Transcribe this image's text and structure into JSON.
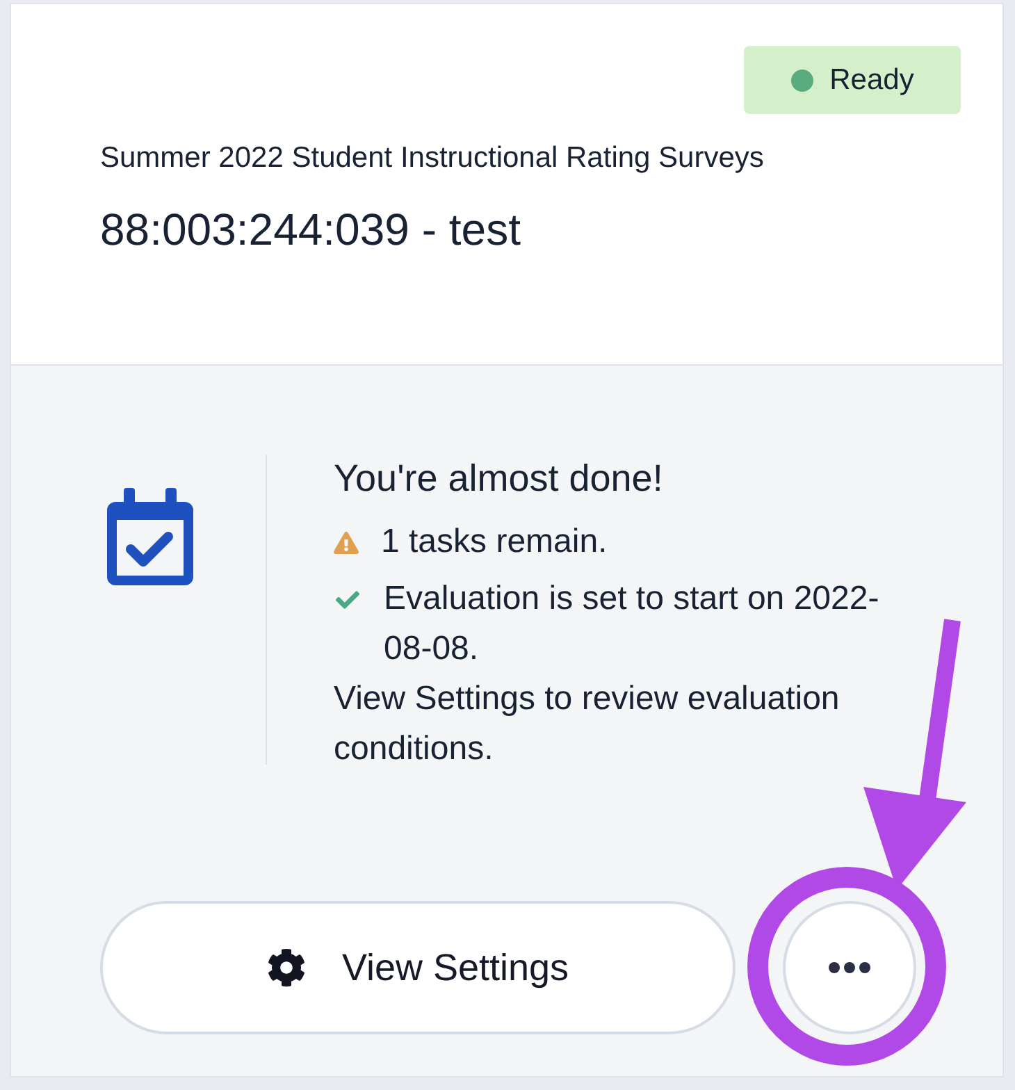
{
  "header": {
    "status": {
      "label": "Ready",
      "color": "#5aab7e"
    },
    "subtitle": "Summer 2022 Student Instructional Rating Surveys",
    "title": "88:003:244:039 - test"
  },
  "progress": {
    "heading": "You're almost done!",
    "items": [
      {
        "kind": "warning",
        "text": "1 tasks remain."
      },
      {
        "kind": "done",
        "text": "Evaluation is set to start on 2022-08-08."
      }
    ],
    "note": "View Settings to review evaluation conditions."
  },
  "actions": {
    "primary": {
      "label": "View Settings"
    },
    "more": {
      "highlighted": true
    }
  }
}
